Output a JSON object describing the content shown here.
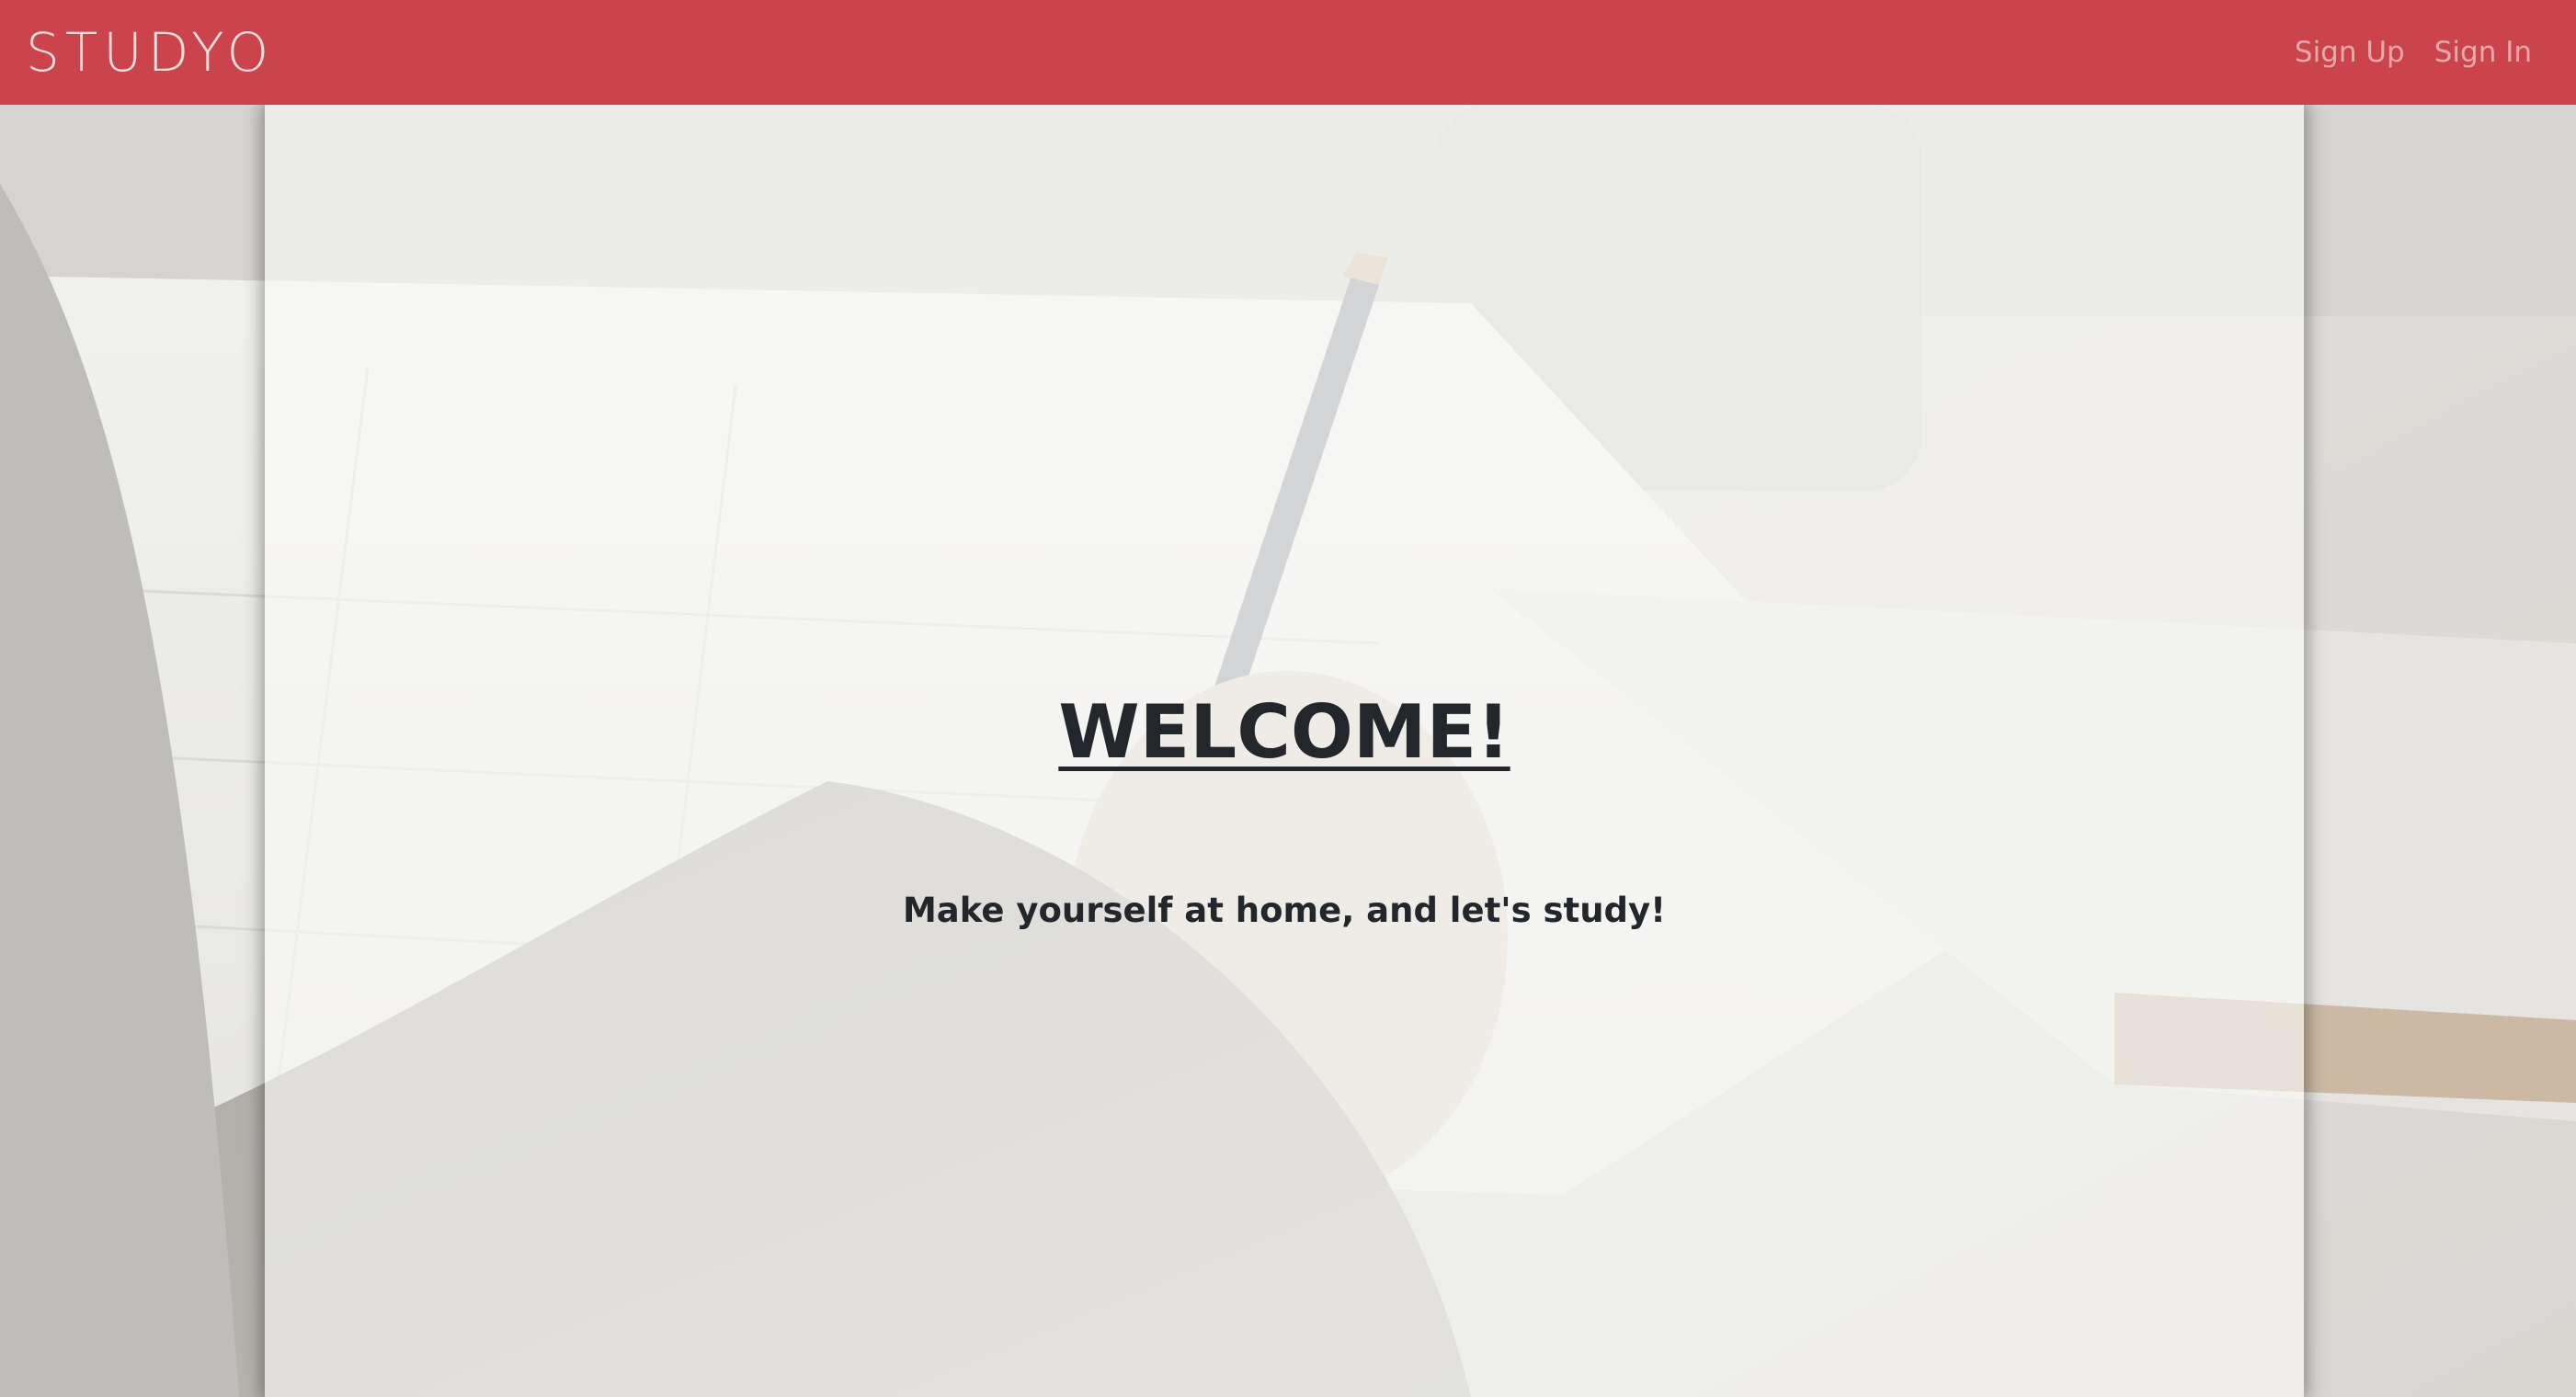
{
  "navbar": {
    "brand": "STUDYO",
    "links": [
      {
        "label": "Sign Up"
      },
      {
        "label": "Sign In"
      }
    ],
    "background_color": "#cc444b"
  },
  "hero": {
    "title": "WELCOME!",
    "subtitle": "Make yourself at home, and let's study!"
  },
  "background": {
    "image": "photo-hand-writing-with-pen-on-paper",
    "overlay_color": "#fafaf8"
  }
}
